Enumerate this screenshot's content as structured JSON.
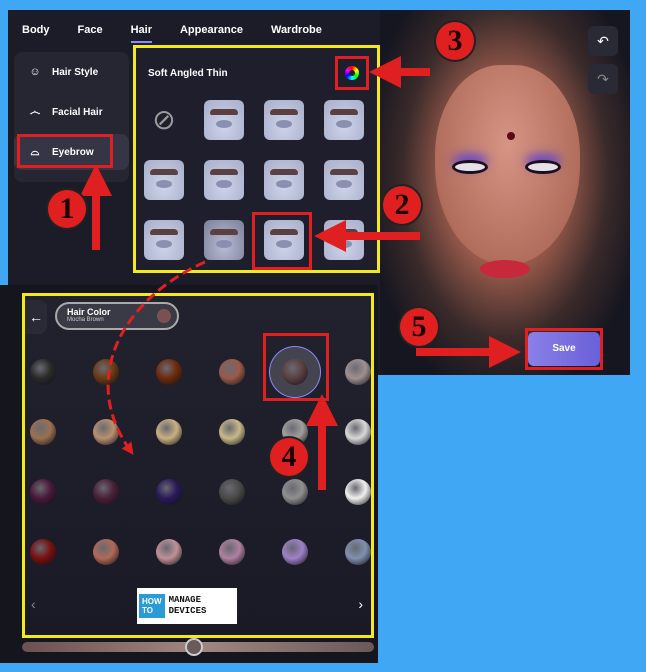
{
  "tabs": [
    {
      "label": "Body"
    },
    {
      "label": "Face"
    },
    {
      "label": "Hair",
      "active": true
    },
    {
      "label": "Appearance"
    },
    {
      "label": "Wardrobe"
    }
  ],
  "sidebar": {
    "items": [
      {
        "label": "Hair Style",
        "icon": "hair-style-icon"
      },
      {
        "label": "Facial Hair",
        "icon": "mustache-icon"
      },
      {
        "label": "Eyebrow",
        "icon": "eyebrow-icon",
        "selected": true
      }
    ]
  },
  "brows": {
    "title": "Soft Angled Thin",
    "selected_index": 9
  },
  "color_panel": {
    "title": "Hair Color",
    "value": "Mocha Brown",
    "selected_index": 4,
    "swatches": [
      "#2a2a2a",
      "#6a3a14",
      "#6e2a0c",
      "#9a5a48",
      "#5a4040",
      "#a09090",
      "#9a7050",
      "#b89070",
      "#c8b080",
      "#c8b888",
      "#a0a0a0",
      "#d8d8d8",
      "#4a1a3a",
      "#4a2038",
      "#2a1a5a",
      "#4a4a4a",
      "#909090",
      "#f0f0f0",
      "#7a1010",
      "#b06a58",
      "#c09098",
      "#b080a0",
      "#a080c8",
      "#8090b0"
    ],
    "slider_value": 0.49
  },
  "actions": {
    "save": "Save"
  },
  "logo": {
    "line1": "HOW TO",
    "line2": "MANAGE DEVICES"
  },
  "annotations": [
    "1",
    "2",
    "3",
    "4",
    "5"
  ],
  "colors": {
    "accent": "#8a8aff",
    "highlight": "#f2ea1c",
    "annotation": "#e02020",
    "background": "#3fa7f4"
  }
}
